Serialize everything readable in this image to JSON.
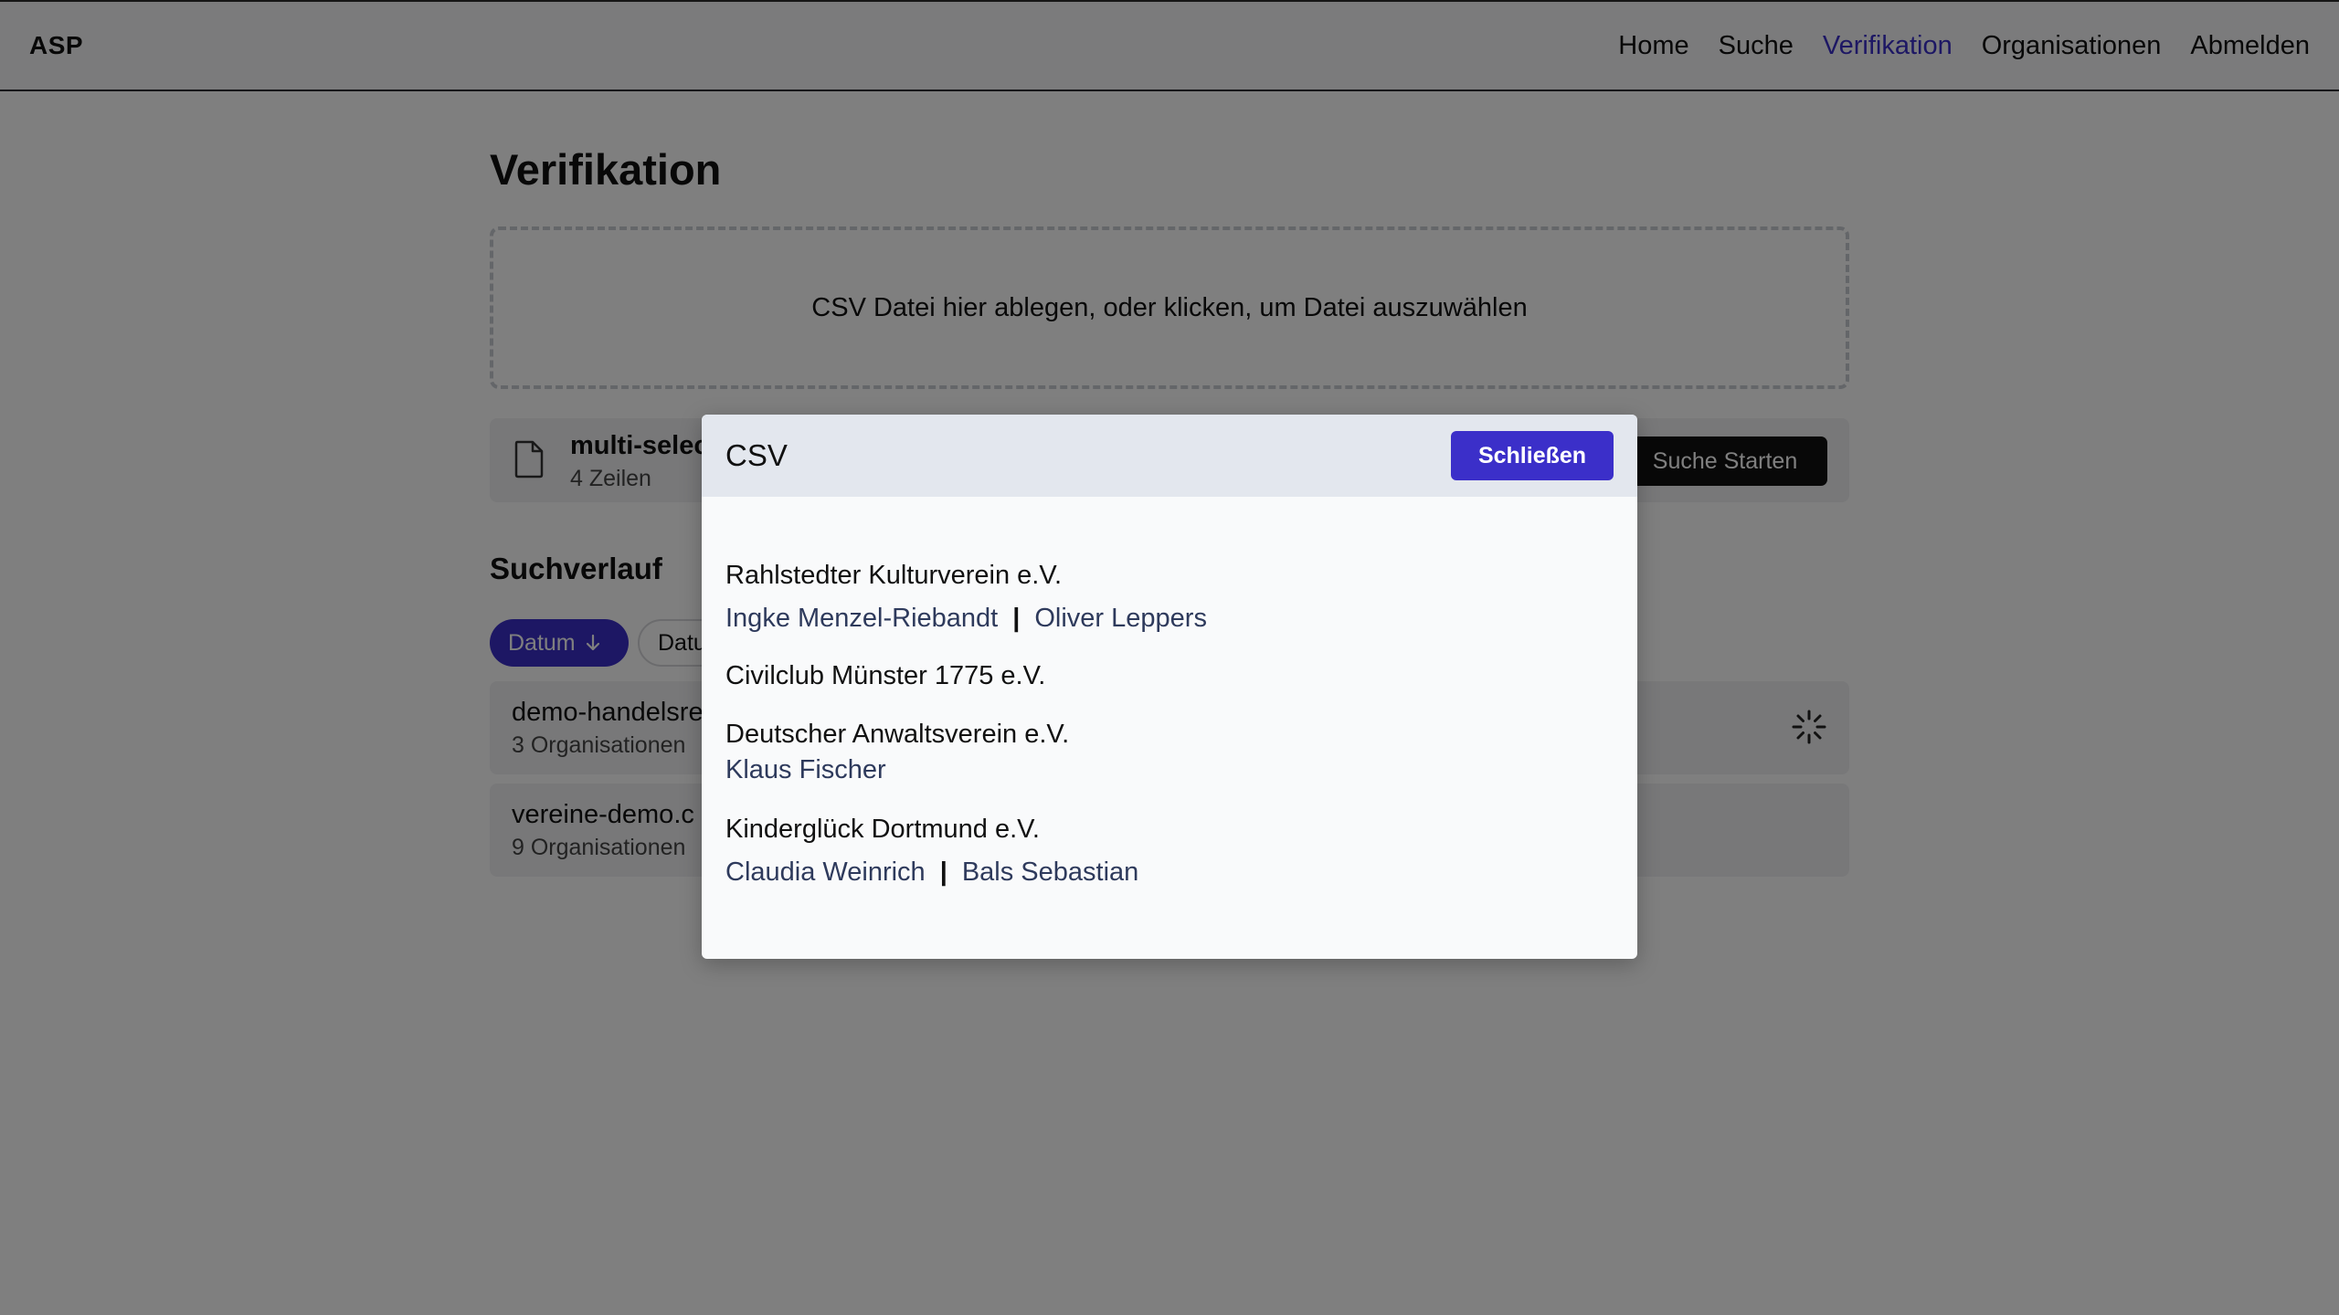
{
  "app": {
    "brand": "ASP"
  },
  "nav": {
    "items": [
      {
        "label": "Home",
        "active": false
      },
      {
        "label": "Suche",
        "active": false
      },
      {
        "label": "Verifikation",
        "active": true
      },
      {
        "label": "Organisationen",
        "active": false
      },
      {
        "label": "Abmelden",
        "active": false
      }
    ]
  },
  "page": {
    "title": "Verifikation",
    "dropzone_text": "CSV Datei hier ablegen, oder klicken, um Datei auszuwählen"
  },
  "file": {
    "name": "multi-selec",
    "rows": "4 Zeilen",
    "start_button": "Suche Starten",
    "icon": "file-icon"
  },
  "history": {
    "title": "Suchverlauf",
    "sort_active": {
      "label": "Datum",
      "icon": "arrow-down-icon"
    },
    "sort_inactive": {
      "label": "Datu"
    },
    "items": [
      {
        "name": "demo-handelsre",
        "count": "3 Organisationen",
        "status_icon": "spinner-icon"
      },
      {
        "name": "vereine-demo.c",
        "count": "9 Organisationen"
      }
    ]
  },
  "modal": {
    "title": "CSV",
    "close_label": "Schließen",
    "organizations": [
      {
        "name": "Rahlstedter Kulturverein e.V.",
        "persons": [
          "Ingke Menzel-Riebandt",
          "Oliver Leppers"
        ]
      },
      {
        "name": "Civilclub Münster 1775 e.V.",
        "persons": []
      },
      {
        "name": "Deutscher Anwaltsverein e.V.",
        "persons": [
          "Klaus Fischer"
        ]
      },
      {
        "name": "Kinderglück Dortmund e.V.",
        "persons": [
          "Claudia Weinrich",
          "Bals Sebastian"
        ]
      }
    ]
  },
  "colors": {
    "accent": "#3b2fc9",
    "overlay": "rgba(0,0,0,0.5)",
    "modal_header": "#e3e7ee",
    "person_link": "#2e3a5c"
  }
}
